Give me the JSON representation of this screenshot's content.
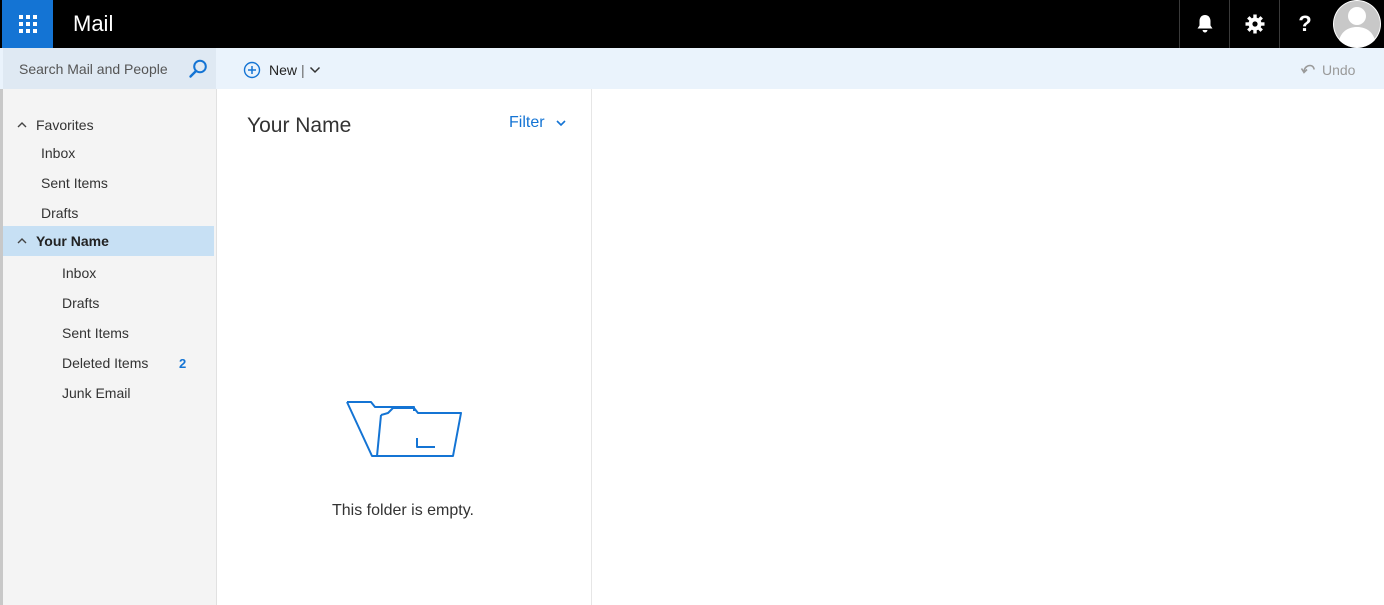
{
  "topbar": {
    "app_title": "Mail",
    "icons": [
      "app-launcher-icon",
      "bell-icon",
      "gear-icon",
      "help-icon",
      "avatar-icon"
    ],
    "help_glyph": "?"
  },
  "commandbar": {
    "search_placeholder": "Search Mail and People",
    "new_label": "New",
    "new_separator": "|",
    "undo_label": "Undo"
  },
  "sidebar": {
    "favorites_label": "Favorites",
    "favorites": [
      "Inbox",
      "Sent Items",
      "Drafts"
    ],
    "account_label": "Your Name",
    "folders": [
      "Inbox",
      "Drafts",
      "Sent Items",
      "Deleted Items",
      "Junk Email"
    ],
    "deleted_count": "2"
  },
  "message_list": {
    "heading": "Your Name",
    "filter_label": "Filter",
    "empty_text": "This folder is empty."
  },
  "colors": {
    "accent": "#1474d4",
    "topbar_bg": "#000000",
    "selected_bg": "#c7e0f4"
  }
}
